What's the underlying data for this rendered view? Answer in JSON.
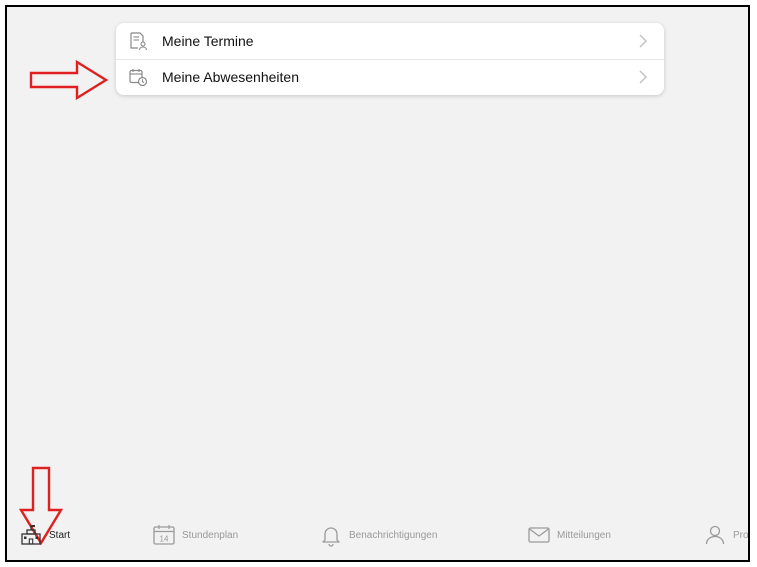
{
  "menu": {
    "items": [
      {
        "label": "Meine Termine",
        "icon": "document-person-icon"
      },
      {
        "label": "Meine Abwesenheiten",
        "icon": "calendar-clock-icon"
      }
    ]
  },
  "tabbar": {
    "tabs": [
      {
        "label": "Start",
        "icon": "school-building-icon",
        "active": true
      },
      {
        "label": "Stundenplan",
        "icon": "calendar-day-icon",
        "day": "14",
        "active": false
      },
      {
        "label": "Benachrichtigungen",
        "icon": "bell-icon",
        "active": false
      },
      {
        "label": "Mitteilungen",
        "icon": "envelope-icon",
        "active": false
      },
      {
        "label": "Profil",
        "icon": "person-icon",
        "active": false
      }
    ]
  },
  "colors": {
    "annotation_arrow": "#e02020",
    "background": "#f2f2f2",
    "active_tab": "#222222",
    "inactive_tab": "#9a9a9a"
  }
}
